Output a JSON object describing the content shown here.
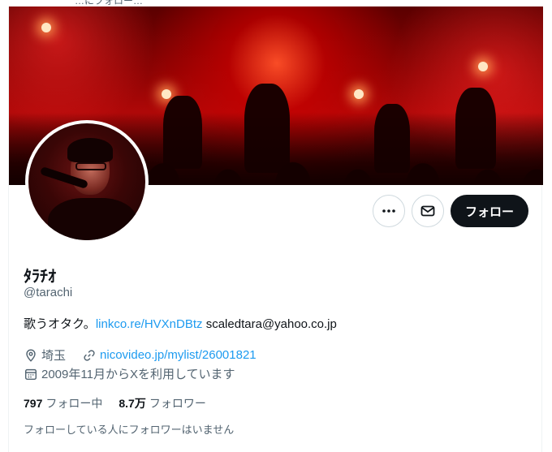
{
  "top_fragment": "…にフォロー…",
  "profile": {
    "display_name": "ﾀﾗﾁｵ",
    "handle": "@tarachi",
    "bio_text": "歌うオタク。",
    "bio_link": "linkco.re/HVXnDBtz",
    "bio_email": "scaledtara@yahoo.co.jp",
    "location": "埼玉",
    "website": "nicovideo.jp/mylist/26001821",
    "joined": "2009年11月からXを利用しています"
  },
  "actions": {
    "more_icon": "more-dots-icon",
    "message_icon": "envelope-icon",
    "follow_label": "フォロー"
  },
  "stats": {
    "following_count": "797",
    "following_label": "フォロー中",
    "followers_count": "8.7万",
    "followers_label": "フォロワー"
  },
  "followers_you_know": "フォローしている人にフォロワーはいません",
  "colors": {
    "link": "#1d9bf0",
    "follow_button": "#0f1419",
    "secondary_text": "#536471"
  }
}
